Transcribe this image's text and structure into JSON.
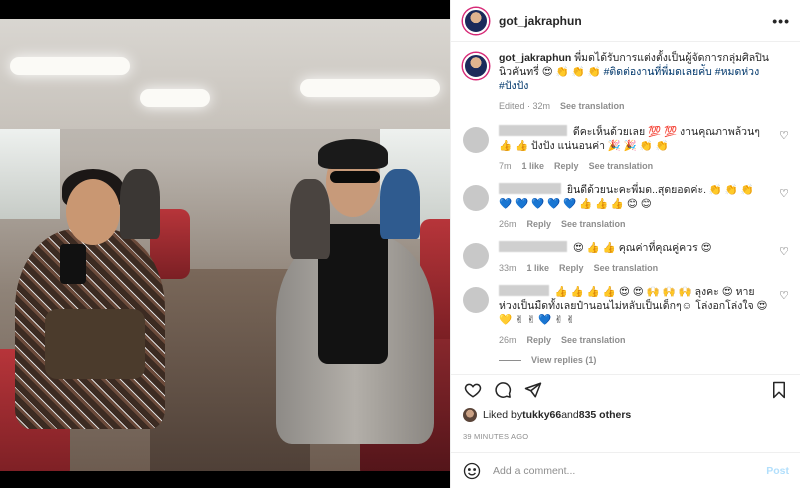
{
  "header": {
    "username": "got_jakraphun",
    "more": "•••"
  },
  "caption": {
    "username": "got_jakraphun",
    "text": "พี่มดได้รับการแต่งตั้งเป็นผู้จัดการกลุ่มศิลปินนิวคันทรี่ 😍 👏 👏 👏 ",
    "hashtags": "#ติดต่องานที่พี่มดเลยค่ับ #หมดห่วง #ปังปัง",
    "edited": "Edited · 32m",
    "see_translation": "See translation"
  },
  "comments": [
    {
      "text": "ดีคะเห็นด้วยเลย 💯 💯 งานคุณภาพล้วนๆ 👍 👍 ปังปัง แน่นอนค่า 🎉 🎉 👏 👏",
      "time": "7m",
      "likes": "1 like",
      "reply": "Reply",
      "translate": "See translation"
    },
    {
      "text": "ยินดีด้วยนะคะพี่มด..สุดยอดค่ะ. 👏 👏 👏 💙 💙 💙 💙 💙 👍 👍 👍 😊 😊",
      "time": "26m",
      "likes": "",
      "reply": "Reply",
      "translate": "See translation"
    },
    {
      "text": "😍 👍 👍 คุณค่าที่คุณคู่ควร 😍",
      "time": "33m",
      "likes": "1 like",
      "reply": "Reply",
      "translate": "See translation"
    },
    {
      "text": "👍 👍 👍 👍 😍 😍 🙌 🙌 🙌 ลุงคะ 😍 หายห่วงเป็นมืดทั้งเลยป๋านอนไม่หลับเป็นเด็กๆ☺ โล่งอกโล่งใจ 😍 💛 ✌ ✌ 💙 ✌ ✌",
      "time": "26m",
      "likes": "",
      "reply": "Reply",
      "translate": "See translation"
    }
  ],
  "view_replies": "View replies (1)",
  "likes": {
    "prefix": "Liked by ",
    "user": "tukky66",
    "mid": " and ",
    "count": "835 others"
  },
  "time_ago": "39 MINUTES AGO",
  "add_comment": {
    "placeholder": "Add a comment...",
    "post": "Post"
  },
  "icons": [
    "heart-icon",
    "comment-icon",
    "share-icon",
    "bookmark-icon",
    "emoji-icon",
    "more-icon"
  ]
}
